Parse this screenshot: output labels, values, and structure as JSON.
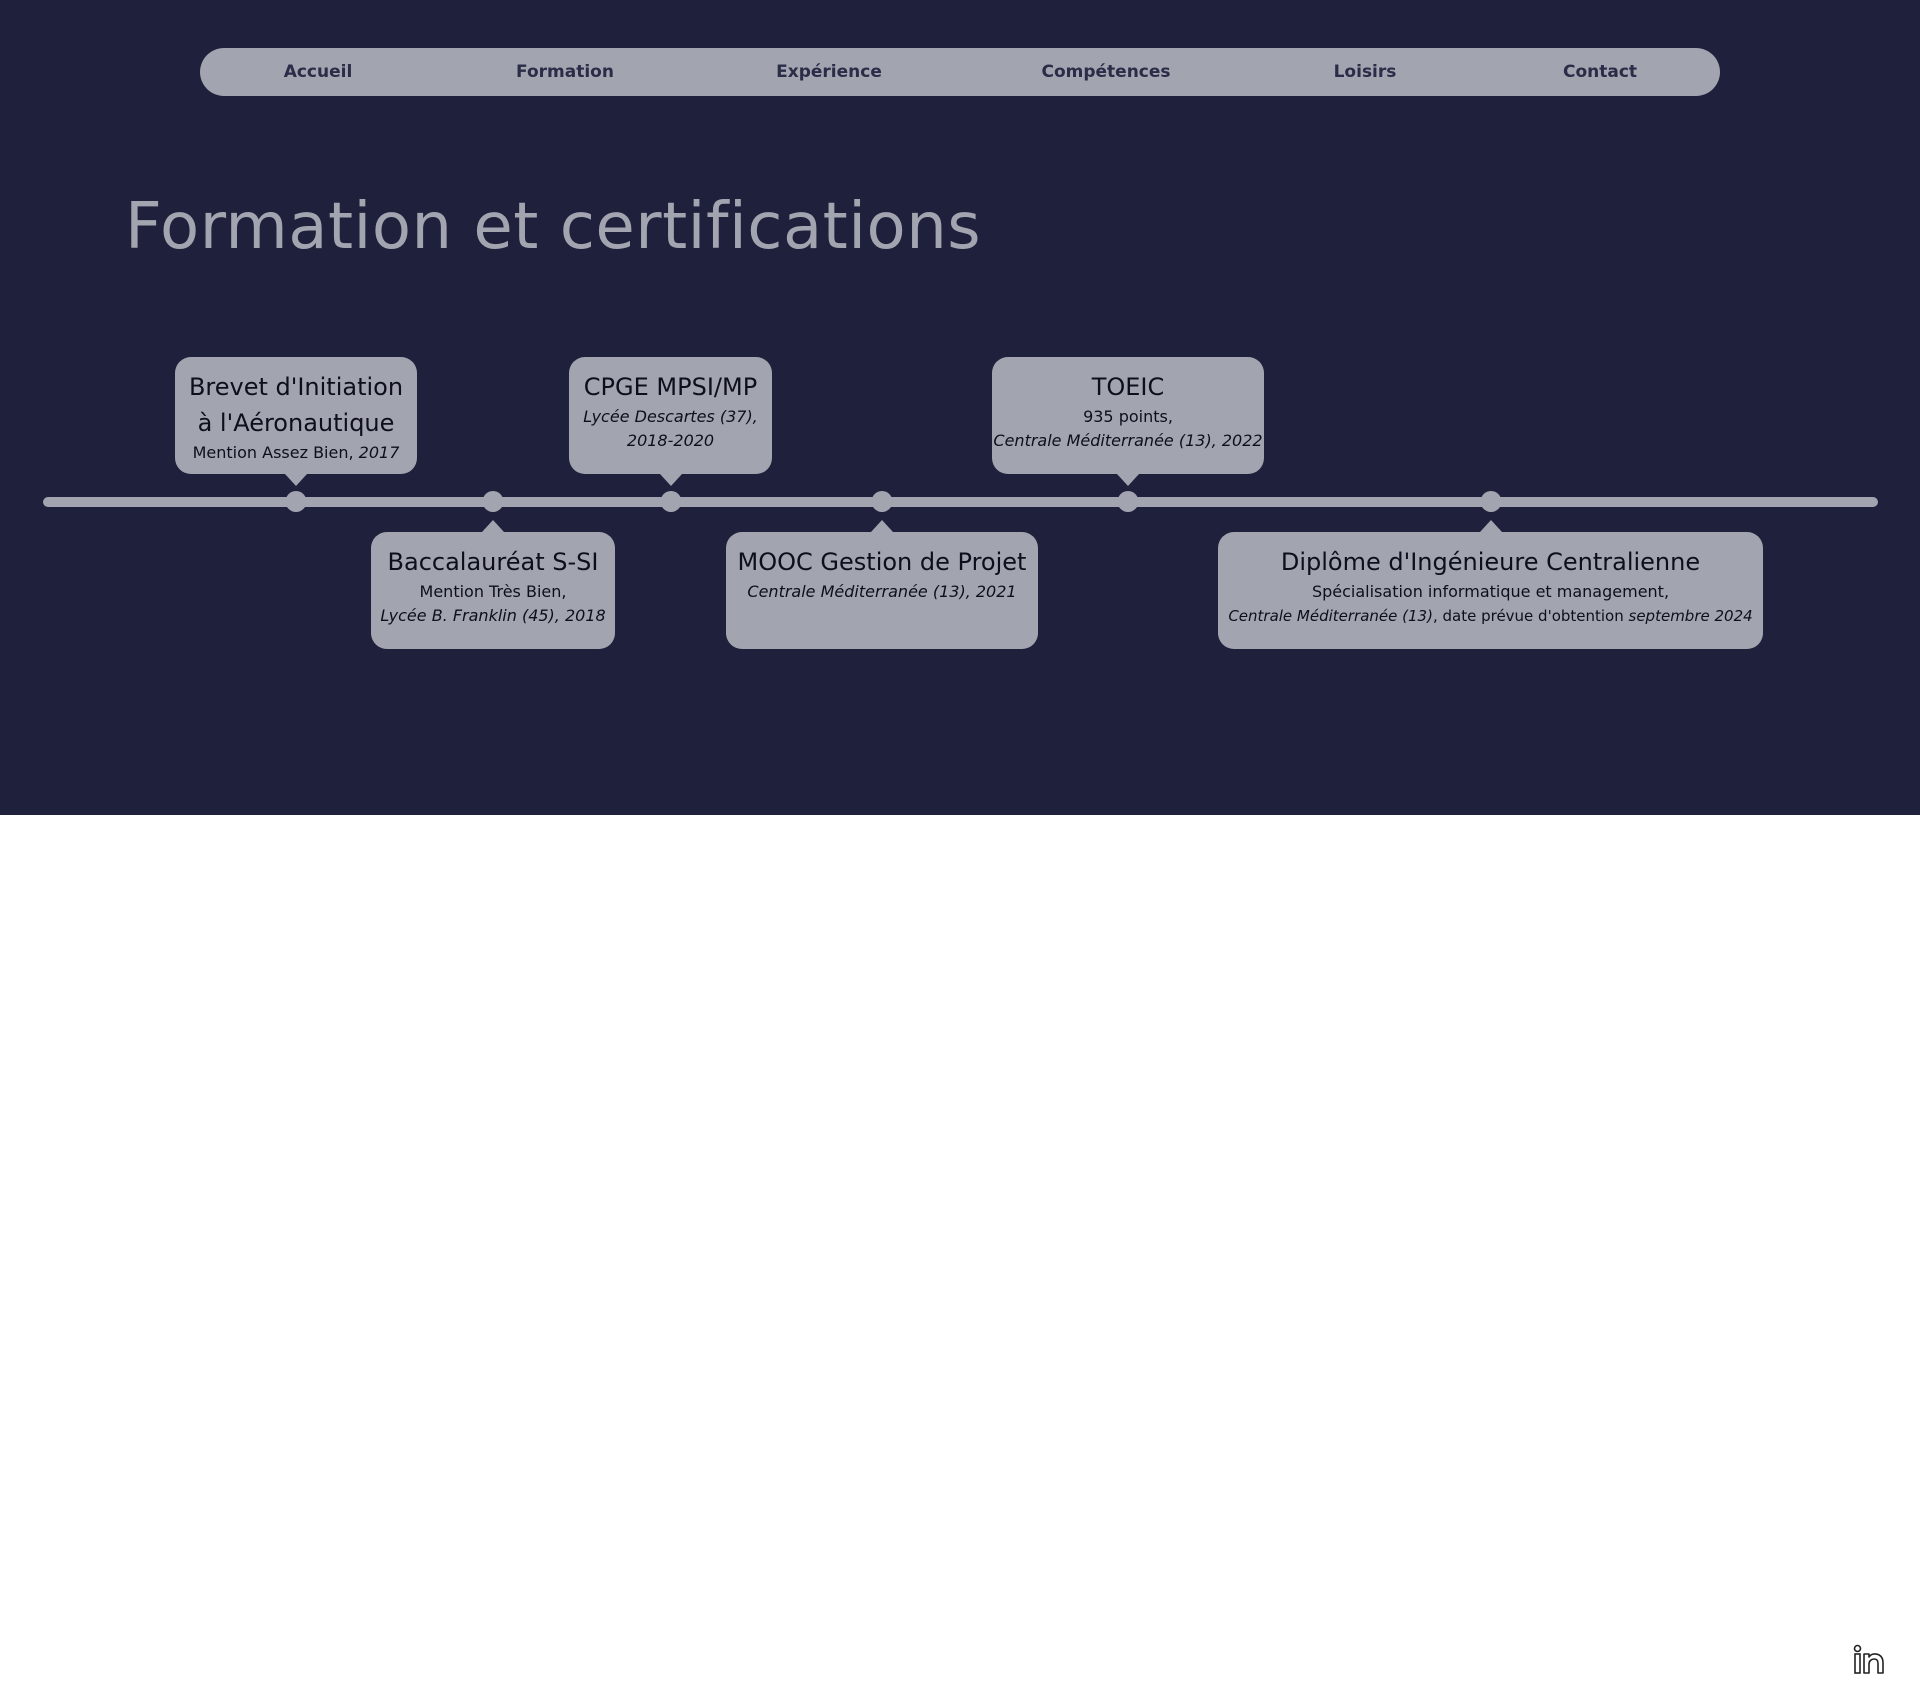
{
  "nav": {
    "items": [
      "Accueil",
      "Formation",
      "Expérience",
      "Compétences",
      "Loisirs",
      "Contact"
    ]
  },
  "page_title": "Formation et certifications",
  "timeline": {
    "cards": [
      {
        "title_lines": [
          "Brevet d'Initiation",
          "à l'Aéronautique"
        ],
        "detail_1": "Mention Assez Bien, ",
        "detail_1_italic": "2017"
      },
      {
        "title_lines": [
          "Baccalauréat S-SI"
        ],
        "detail_1": "Mention Très Bien,",
        "detail_2_italic": "Lycée B. Franklin (45), 2018"
      },
      {
        "title_lines": [
          "CPGE MPSI/MP"
        ],
        "detail_1_italic": "Lycée Descartes (37),",
        "detail_2_italic": "2018-2020"
      },
      {
        "title_lines": [
          "MOOC Gestion de Projet"
        ],
        "detail_1_italic": "Centrale Méditerranée (13), 2021"
      },
      {
        "title_lines": [
          "TOEIC"
        ],
        "detail_1": "935 points,",
        "detail_2_italic": "Centrale Méditerranée (13), 2022"
      },
      {
        "title_lines": [
          "Diplôme d'Ingénieure Centralienne"
        ],
        "detail_1": "Spécialisation informatique et management,",
        "detail_2_italic_a": "Centrale Méditerranée (13)",
        "detail_2_plain": ", date prévue d'obtention ",
        "detail_2_italic_b": "septembre 2024"
      }
    ]
  },
  "footer": {
    "social_icon": "linkedin-icon"
  },
  "colors": {
    "background": "#1f203b",
    "accent": "#a2a4b0",
    "footer": "#ffffff"
  }
}
